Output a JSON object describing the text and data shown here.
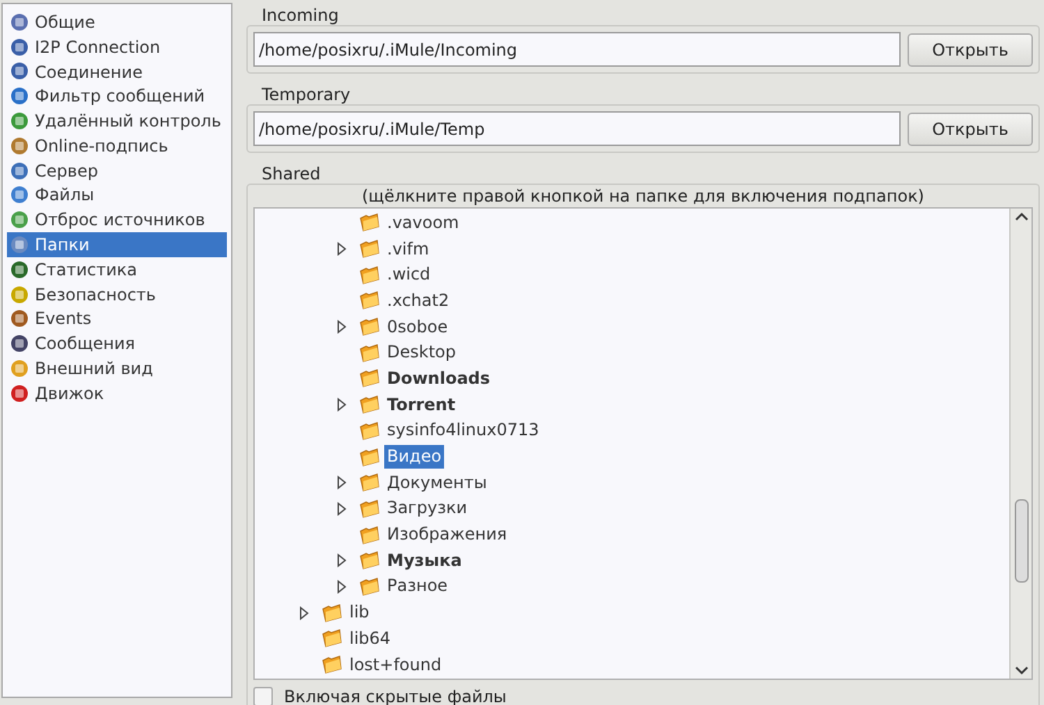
{
  "sidebar": {
    "items": [
      {
        "label": "Общие",
        "selected": false
      },
      {
        "label": "I2P Connection",
        "selected": false
      },
      {
        "label": "Соединение",
        "selected": false
      },
      {
        "label": "Фильтр сообщений",
        "selected": false
      },
      {
        "label": "Удалённый контроль",
        "selected": false
      },
      {
        "label": "Online-подпись",
        "selected": false
      },
      {
        "label": "Сервер",
        "selected": false
      },
      {
        "label": "Файлы",
        "selected": false
      },
      {
        "label": "Отброс источников",
        "selected": false
      },
      {
        "label": "Папки",
        "selected": true
      },
      {
        "label": "Статистика",
        "selected": false
      },
      {
        "label": "Безопасность",
        "selected": false
      },
      {
        "label": "Events",
        "selected": false
      },
      {
        "label": "Сообщения",
        "selected": false
      },
      {
        "label": "Внешний вид",
        "selected": false
      },
      {
        "label": "Движок",
        "selected": false
      }
    ]
  },
  "incoming": {
    "label": "Incoming",
    "value": "/home/posixru/.iMule/Incoming",
    "button": "Открыть"
  },
  "temporary": {
    "label": "Temporary",
    "value": "/home/posixru/.iMule/Temp",
    "button": "Открыть"
  },
  "shared": {
    "label": "Shared",
    "hint": "(щёлкните правой кнопкой на папке для включения подпапок)",
    "tree": {
      "scrolled_parent_children": [
        {
          "name": ".vavoom",
          "expandable": false,
          "bold": false,
          "selected": false
        },
        {
          "name": ".vifm",
          "expandable": true,
          "bold": false,
          "selected": false
        },
        {
          "name": ".wicd",
          "expandable": false,
          "bold": false,
          "selected": false
        },
        {
          "name": ".xchat2",
          "expandable": false,
          "bold": false,
          "selected": false
        },
        {
          "name": "0soboe",
          "expandable": true,
          "bold": false,
          "selected": false
        },
        {
          "name": "Desktop",
          "expandable": false,
          "bold": false,
          "selected": false
        },
        {
          "name": "Downloads",
          "expandable": false,
          "bold": true,
          "selected": false
        },
        {
          "name": "Torrent",
          "expandable": true,
          "bold": true,
          "selected": false
        },
        {
          "name": "sysinfo4linux0713",
          "expandable": false,
          "bold": false,
          "selected": false
        },
        {
          "name": "Видео",
          "expandable": false,
          "bold": false,
          "selected": true
        },
        {
          "name": "Документы",
          "expandable": true,
          "bold": false,
          "selected": false
        },
        {
          "name": "Загрузки",
          "expandable": true,
          "bold": false,
          "selected": false
        },
        {
          "name": "Изображения",
          "expandable": false,
          "bold": false,
          "selected": false
        },
        {
          "name": "Музыка",
          "expandable": true,
          "bold": true,
          "selected": false
        },
        {
          "name": "Разное",
          "expandable": true,
          "bold": false,
          "selected": false
        }
      ],
      "items": [
        {
          "name": "lib",
          "expandable": true,
          "bold": false,
          "selected": false
        },
        {
          "name": "lib64",
          "expandable": false,
          "bold": false,
          "selected": false
        },
        {
          "name": "lost+found",
          "expandable": false,
          "bold": false,
          "selected": false
        }
      ]
    },
    "show_hidden": {
      "label": "Включая скрытые файлы",
      "checked": false
    }
  }
}
